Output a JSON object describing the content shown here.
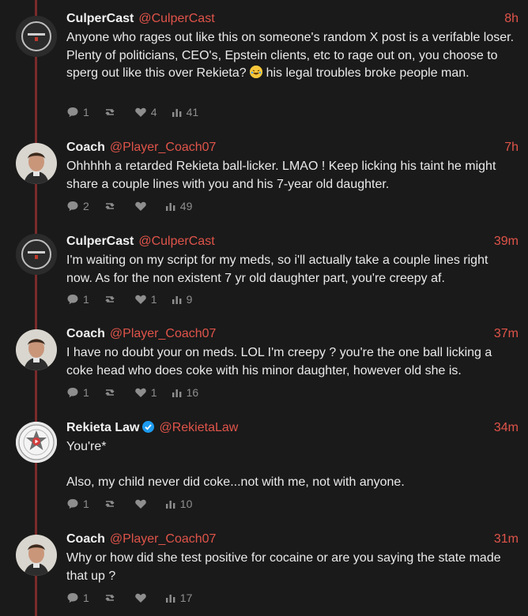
{
  "colors": {
    "background": "#1a1a1a",
    "accent": "#e0544a",
    "thread_line": "#7a2a2a",
    "muted": "#8e8e8e",
    "verified": "#1d9bf0"
  },
  "icons": {
    "reply": "comment-bubble-icon",
    "repost": "repost-arrows-icon",
    "like": "heart-icon",
    "views": "bar-chart-icon"
  },
  "tweets": [
    {
      "name": "CulperCast",
      "handle": "@CulperCast",
      "time": "8h",
      "text_before_emoji": "Anyone who rages out like this on someone's random X post is a verifable loser. Plenty of politicians, CEO's, Epstein clients, etc to rage out on, you choose to sperg out like this over Rekieta? ",
      "text_after_emoji": " his legal troubles broke people man.",
      "replies": "1",
      "reposts": "",
      "likes": "4",
      "views": "41"
    },
    {
      "name": "Coach",
      "handle": "@Player_Coach07",
      "time": "7h",
      "text": "Ohhhhh a retarded Rekieta ball-licker. LMAO ! Keep licking his taint he might share a couple lines with you and his 7-year old daughter.",
      "replies": "2",
      "reposts": "",
      "likes": "",
      "views": "49"
    },
    {
      "name": "CulperCast",
      "handle": "@CulperCast",
      "time": "39m",
      "text": "I'm waiting on my script for my meds, so i'll actually take a couple lines right now. As for the non existent 7 yr old daughter part, you're creepy af.",
      "replies": "1",
      "reposts": "",
      "likes": "1",
      "views": "9"
    },
    {
      "name": "Coach",
      "handle": "@Player_Coach07",
      "time": "37m",
      "text": "I have no doubt your on meds. LOL I'm creepy ? you're the one ball licking a coke head who does coke with his minor daughter, however old she is.",
      "replies": "1",
      "reposts": "",
      "likes": "1",
      "views": "16"
    },
    {
      "name": "Rekieta Law",
      "handle": "@RekietaLaw",
      "time": "34m",
      "text": "You're*\n\nAlso, my child never did coke...not with me, not with anyone.",
      "replies": "1",
      "reposts": "",
      "likes": "",
      "views": "10"
    },
    {
      "name": "Coach",
      "handle": "@Player_Coach07",
      "time": "31m",
      "text": "Why or how did she test positive for cocaine or are you saying the state made that up ?",
      "replies": "1",
      "reposts": "",
      "likes": "",
      "views": "17"
    }
  ]
}
